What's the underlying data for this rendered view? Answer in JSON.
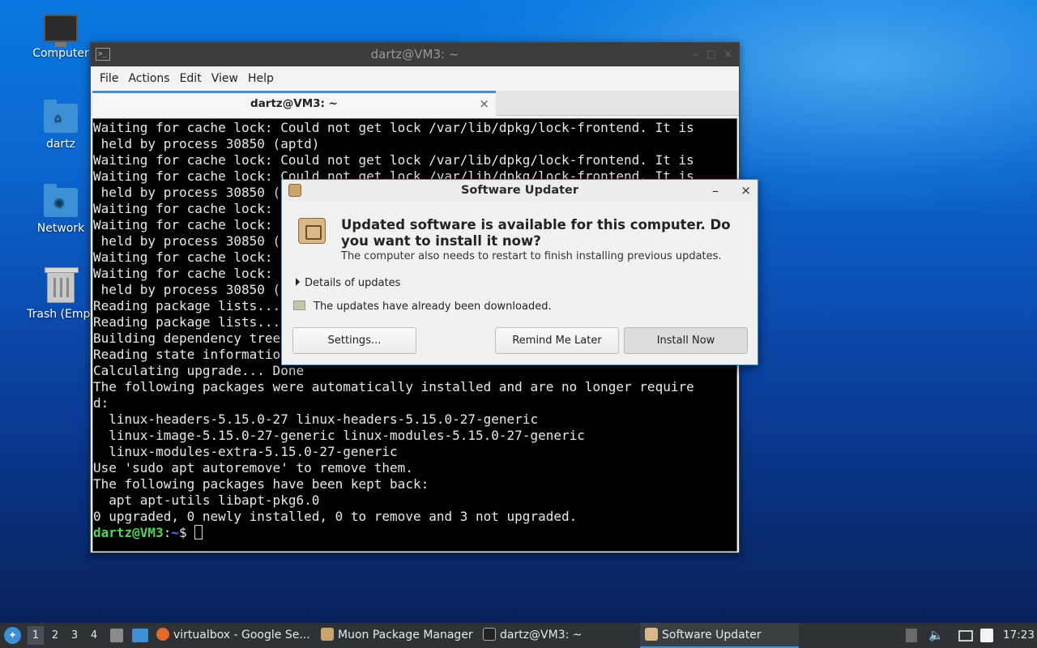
{
  "desktop": {
    "icons": [
      {
        "label": "Computer"
      },
      {
        "label": "dartz"
      },
      {
        "label": "Network"
      },
      {
        "label": "Trash (Empt"
      }
    ]
  },
  "terminal": {
    "title": "dartz@VM3: ~",
    "menu": [
      "File",
      "Actions",
      "Edit",
      "View",
      "Help"
    ],
    "tab_label": "dartz@VM3: ~",
    "tab_close": "×",
    "lines": [
      "Waiting for cache lock: Could not get lock /var/lib/dpkg/lock-frontend. It is",
      " held by process 30850 (aptd)",
      "Waiting for cache lock: Could not get lock /var/lib/dpkg/lock-frontend. It is",
      "Waiting for cache lock: Could not get lock /var/lib/dpkg/lock-frontend. It is",
      " held by process 30850 (aptd)",
      "Waiting for cache lock: Could not get lock /var/lib/dpkg/lock-frontend. It is",
      "Waiting for cache lock: Could not get lock /var/lib/dpkg/lock-frontend. It is",
      " held by process 30850 (aptd)",
      "Waiting for cache lock: Could not get lock /var/lib/dpkg/lock-frontend. It is",
      "Waiting for cache lock: Could not get lock /var/lib/dpkg/lock-frontend. It is",
      " held by process 30850 (aptd)",
      "Reading package lists... Done",
      "Reading package lists... Done",
      "Building dependency tree... Done",
      "Reading state information... Done",
      "Calculating upgrade... Done",
      "The following packages were automatically installed and are no longer require",
      "d:",
      "  linux-headers-5.15.0-27 linux-headers-5.15.0-27-generic",
      "  linux-image-5.15.0-27-generic linux-modules-5.15.0-27-generic",
      "  linux-modules-extra-5.15.0-27-generic",
      "Use 'sudo apt autoremove' to remove them.",
      "The following packages have been kept back:",
      "  apt apt-utils libapt-pkg6.0",
      "0 upgraded, 0 newly installed, 0 to remove and 3 not upgraded."
    ],
    "prompt_user": "dartz@VM3",
    "prompt_sep": ":",
    "prompt_path": "~",
    "prompt_symbol": "$ "
  },
  "updater": {
    "title": "Software Updater",
    "minimize": "–",
    "close": "×",
    "heading": "Updated software is available for this computer. Do you want to install it now?",
    "subtext": "The computer also needs to restart to finish installing previous updates.",
    "details_label": "Details of updates",
    "downloaded_text": "The updates have already been downloaded.",
    "buttons": {
      "settings": "Settings...",
      "remind": "Remind Me Later",
      "install": "Install Now"
    }
  },
  "taskbar": {
    "workspaces": [
      "1",
      "2",
      "3",
      "4"
    ],
    "tasks": [
      {
        "label": "virtualbox - Google Se..."
      },
      {
        "label": "Muon Package Manager"
      },
      {
        "label": "dartz@VM3: ~"
      },
      {
        "label": "Software Updater"
      }
    ],
    "clock": "17:23"
  }
}
